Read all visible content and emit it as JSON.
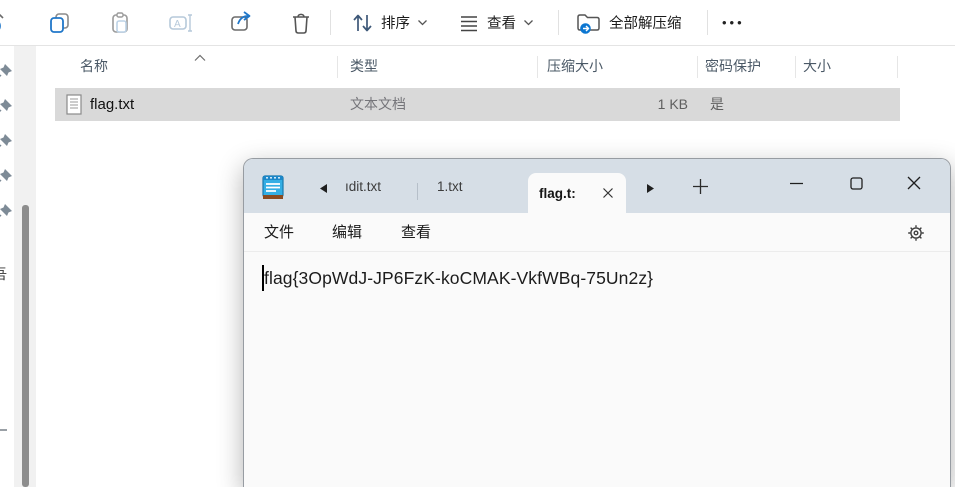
{
  "explorer": {
    "toolbar": {
      "sort": "排序",
      "view": "查看",
      "extract_all": "全部解压缩",
      "more": "•••"
    },
    "columns": [
      "名称",
      "类型",
      "压缩大小",
      "密码保护",
      "大小"
    ],
    "row": {
      "name": "flag.txt",
      "type": "文本文档",
      "compressed_size": "1 KB",
      "password_protected": "是"
    },
    "nav_clipped_text": "吾"
  },
  "notepad": {
    "tabs": {
      "previous": "ıdit.txt",
      "second": "1.txt",
      "active": "flag.t:"
    },
    "menu": [
      "文件",
      "编辑",
      "查看"
    ],
    "content": "flag{3OpWdJ-JP6FzK-koCMAK-VkfWBq-75Un2z}"
  },
  "colors": {
    "accent_blue": "#2077c9",
    "titlebar": "#d6dee6",
    "selected_row": "#d9d9d9"
  }
}
